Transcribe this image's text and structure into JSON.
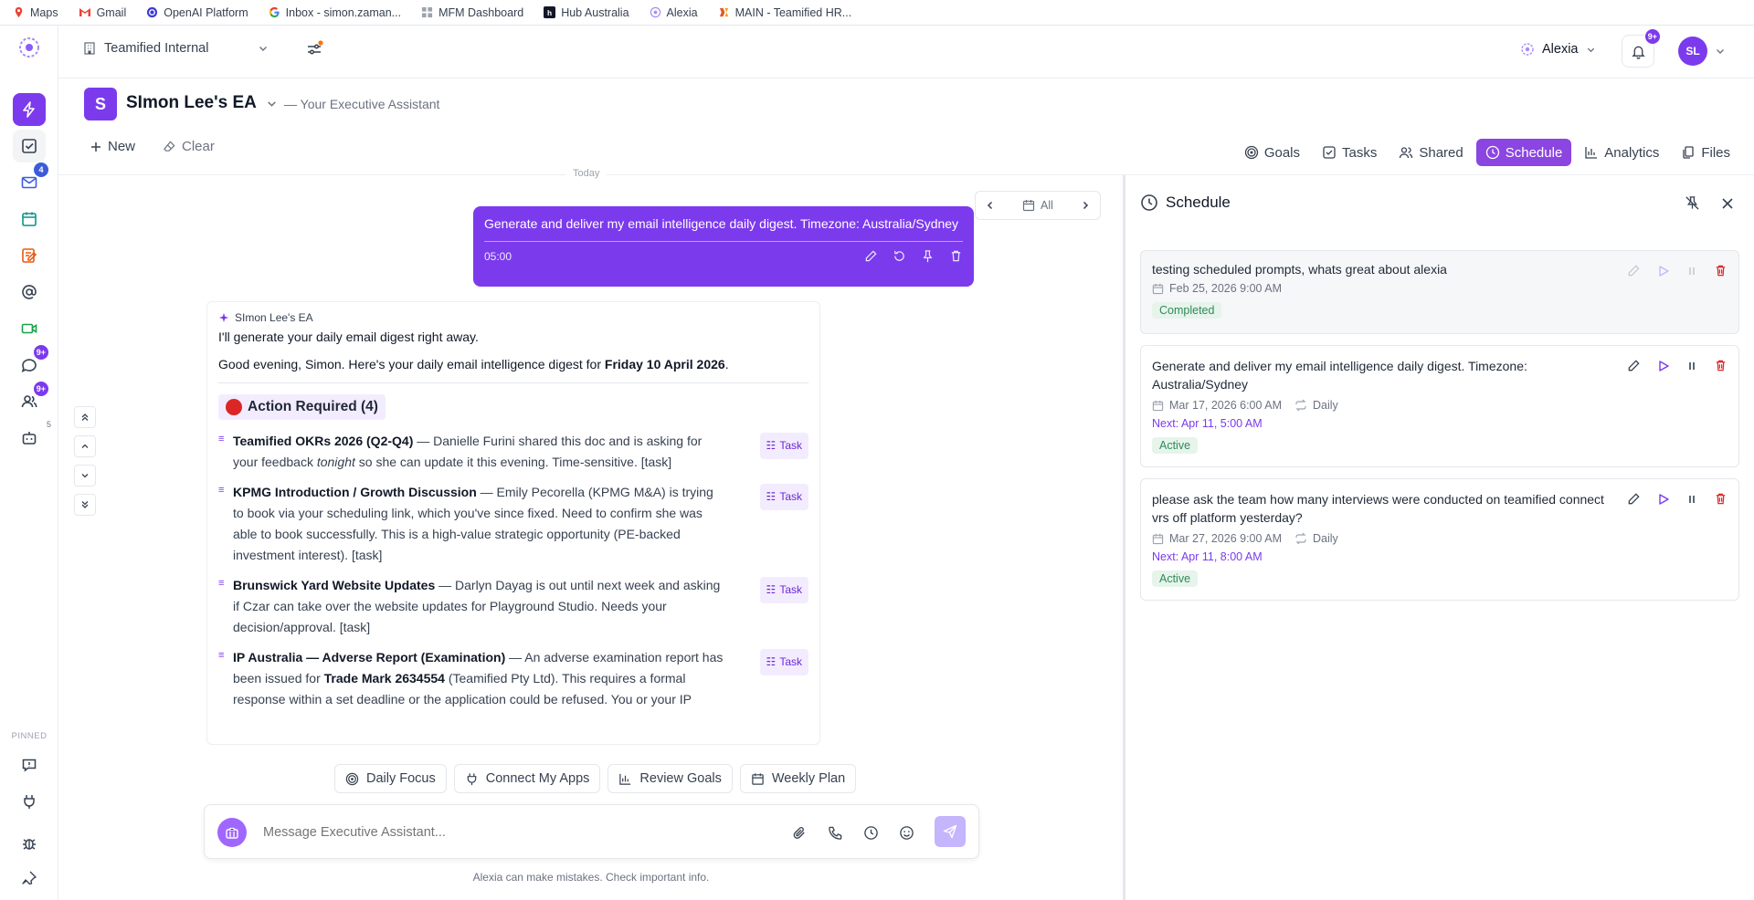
{
  "bookmarks": [
    {
      "label": "Maps",
      "icon": "maps-icon",
      "color": "#34a853"
    },
    {
      "label": "Gmail",
      "icon": "gmail-icon",
      "color": "#ea4335"
    },
    {
      "label": "OpenAI Platform",
      "icon": "openai-icon",
      "color": "#3b3bd6"
    },
    {
      "label": "Inbox - simon.zaman...",
      "icon": "google-icon",
      "color": "#4285f4"
    },
    {
      "label": "MFM Dashboard",
      "icon": "dashboard-icon",
      "color": "#9ca3af"
    },
    {
      "label": "Hub Australia",
      "icon": "hub-icon",
      "color": "#111827"
    },
    {
      "label": "Alexia",
      "icon": "alexia-icon",
      "color": "#a78bfa"
    },
    {
      "label": "MAIN - Teamified HR...",
      "icon": "teamified-icon",
      "color": "#e4572e"
    }
  ],
  "rail": {
    "mail_badge": "4",
    "chat_badge": "9+",
    "people_badge": "9+",
    "bot_count": "5",
    "pinned_label": "PINNED"
  },
  "topbar": {
    "workspace": "Teamified Internal",
    "assistant_name": "Alexia",
    "notification_badge": "9+",
    "user_initials": "SL"
  },
  "ea": {
    "avatar_letter": "S",
    "title": "SImon Lee's EA",
    "subtitle": "— Your Executive Assistant"
  },
  "toolbar": {
    "new_label": "New",
    "clear_label": "Clear",
    "tabs": [
      {
        "label": "Goals",
        "icon": "target-icon",
        "active": false
      },
      {
        "label": "Tasks",
        "icon": "checkbox-icon",
        "active": false
      },
      {
        "label": "Shared",
        "icon": "users-icon",
        "active": false
      },
      {
        "label": "Schedule",
        "icon": "clock-icon",
        "active": true
      },
      {
        "label": "Analytics",
        "icon": "bar-chart-icon",
        "active": false
      },
      {
        "label": "Files",
        "icon": "files-icon",
        "active": false
      }
    ]
  },
  "chat": {
    "date_label": "Today",
    "filter_label": "All",
    "user_message": "Generate and deliver my email intelligence daily digest. Timezone: Australia/Sydney",
    "user_message_time": "05:00",
    "assistant_name": "SImon Lee's EA",
    "intro_line": "I'll generate your daily email digest right away.",
    "greeting_prefix": "Good evening, Simon. Here's your daily email intelligence digest for ",
    "greeting_date": "Friday 10 April 2026",
    "greeting_suffix": ".",
    "section_title": "Action Required (4)",
    "items": [
      {
        "bold": "Teamified OKRs 2026 (Q2-Q4)",
        "text1": " — Danielle Furini shared this doc and is asking for your feedback ",
        "italic": "tonight",
        "text2": " so she can update it this evening. Time-sensitive. [task]",
        "chip": "Task"
      },
      {
        "bold": "KPMG Introduction / Growth Discussion",
        "text1": " — Emily Pecorella (KPMG M&A) is trying to book via your scheduling link, which you've since fixed. Need to confirm she was able to book successfully. This is a high-value strategic opportunity (PE-backed investment interest). [task]",
        "chip": "Task"
      },
      {
        "bold": "Brunswick Yard Website Updates",
        "text1": " — Darlyn Dayag is out until next week and asking if Czar can take over the website updates for Playground Studio. Needs your decision/approval. [task]",
        "chip": "Task"
      },
      {
        "bold": "IP Australia — Adverse Report (Examination)",
        "text1": " — An adverse examination report has been issued for ",
        "bold2": "Trade Mark 2634554",
        "text2": " (Teamified Pty Ltd). This requires a formal response within a set deadline or the application could be refused. You or your IP",
        "chip": "Task"
      }
    ],
    "quick_actions": [
      {
        "label": "Daily Focus",
        "icon": "target-icon"
      },
      {
        "label": "Connect My Apps",
        "icon": "plug-icon"
      },
      {
        "label": "Review Goals",
        "icon": "bar-chart-icon"
      },
      {
        "label": "Weekly Plan",
        "icon": "calendar-icon"
      }
    ],
    "input_placeholder": "Message Executive Assistant...",
    "disclaimer": "Alexia can make mistakes. Check important info."
  },
  "schedule": {
    "title": "Schedule",
    "items": [
      {
        "prompt": "testing scheduled prompts, whats great about alexia",
        "date": "Feb 25, 2026 9:00 AM",
        "recurrence": "",
        "next": "",
        "status": "Completed"
      },
      {
        "prompt": "Generate and deliver my email intelligence daily digest. Timezone: Australia/Sydney",
        "date": "Mar 17, 2026 6:00 AM",
        "recurrence": "Daily",
        "next": "Next: Apr 11, 5:00 AM",
        "status": "Active"
      },
      {
        "prompt": "please ask the team how many interviews were conducted on teamified connect vrs off platform yesterday?",
        "date": "Mar 27, 2026 9:00 AM",
        "recurrence": "Daily",
        "next": "Next: Apr 11, 8:00 AM",
        "status": "Active"
      }
    ]
  },
  "colors": {
    "accent": "#7c3aed",
    "active_green": "#2f8a57",
    "delete_red": "#dc2626"
  }
}
